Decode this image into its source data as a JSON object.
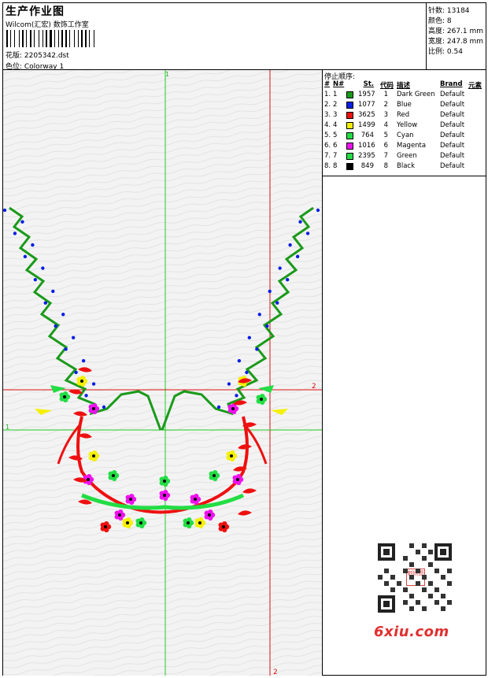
{
  "header": {
    "title": "生产作业图",
    "company": "Wilcom(汇宏) 数饰工作室",
    "design_label": "花版: 2205342.dst",
    "colorway_label": "色位: Colorway 1"
  },
  "stats": {
    "stitches": "针数: 13184",
    "colors": "颜色: 8",
    "height": "高度: 267.1 mm",
    "width": "宽度: 247.8 mm",
    "scale": "比例: 0.54"
  },
  "stop_order": {
    "title": "停止顺序:",
    "columns": {
      "stop": "#",
      "no": "N#",
      "st": "St.",
      "code": "代码",
      "desc": "描述",
      "brand": "Brand",
      "elem": "元素"
    },
    "rows": [
      {
        "stop": "1.",
        "no": "1",
        "st": "1957",
        "code": "1",
        "desc": "Dark Green",
        "brand": "Default",
        "color": "#1a9a1a"
      },
      {
        "stop": "2.",
        "no": "2",
        "st": "1077",
        "code": "2",
        "desc": "Blue",
        "brand": "Default",
        "color": "#0a1ee6"
      },
      {
        "stop": "3.",
        "no": "3",
        "st": "3625",
        "code": "3",
        "desc": "Red",
        "brand": "Default",
        "color": "#ee1010"
      },
      {
        "stop": "4.",
        "no": "4",
        "st": "1499",
        "code": "4",
        "desc": "Yellow",
        "brand": "Default",
        "color": "#f4f000"
      },
      {
        "stop": "5.",
        "no": "5",
        "st": "764",
        "code": "5",
        "desc": "Cyan",
        "brand": "Default",
        "color": "#22dd44"
      },
      {
        "stop": "6.",
        "no": "6",
        "st": "1016",
        "code": "6",
        "desc": "Magenta",
        "brand": "Default",
        "color": "#ee10ee"
      },
      {
        "stop": "7.",
        "no": "7",
        "st": "2395",
        "code": "7",
        "desc": "Green",
        "brand": "Default",
        "color": "#22dd44"
      },
      {
        "stop": "8.",
        "no": "8",
        "st": "849",
        "code": "8",
        "desc": "Black",
        "brand": "Default",
        "color": "#000000"
      }
    ]
  },
  "guides": {
    "v1": "1",
    "v2": "2",
    "h2": "2",
    "h1": "1"
  },
  "watermark": {
    "site": "6xiu.com",
    "logo_text": "刺绣图"
  }
}
